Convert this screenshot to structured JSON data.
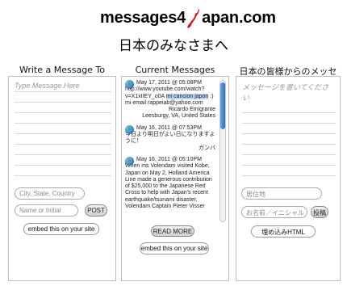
{
  "header": {
    "logo_left": "messages4",
    "logo_right": "apan.com",
    "subtitle": "日本のみなさまへ"
  },
  "left": {
    "title": "Write a Message To Japan",
    "message_placeholder": "Type Message Here",
    "location_placeholder": "City, State, Country",
    "name_placeholder": "Name or Initial",
    "post_label": "POST",
    "embed_label": "embed this on your site"
  },
  "middle": {
    "title": "Current Messages",
    "messages": [
      {
        "date": "May 17, 2011 @ 05:08PM",
        "body_a": "http://www.youtube.com/watch?v=X1xIIEY_o0A ",
        "body_hl": "mi cancion japon",
        "body_b": " :) mi email rappeiab@yahoo.com",
        "sig1": "Ricardo Emigrante",
        "sig2": "Leesburgy, VA, United States"
      },
      {
        "date": "May 16, 2011 @ 07:53PM",
        "body": "今日より明日がよい日になりますように！",
        "sig1": "ガンバ"
      },
      {
        "date": "May 16, 2011 @ 05:10PM",
        "body": "When ms Volendam visited Kobe, Japan on May 2, Holland America Line made a generous contribution of $25,000 to the Japanese Red Cross to help with Japan's recent earthquake/tsunami disaster. Volendam Captain Pieter Visser"
      }
    ],
    "read_more_label": "READ MORE",
    "embed_label": "embed this on your site"
  },
  "right": {
    "title": "日本の皆様からのメッセージ",
    "message_placeholder": "メッセージを書いてください",
    "location_placeholder": "居住地",
    "name_placeholder": "お名前／イニシャル",
    "post_label": "投稿",
    "embed_label": "埋め込みHTML"
  },
  "colors": {
    "logo_accent": "#d01818",
    "scroll_thumb": "#2c6fc2",
    "highlight": "#bcd6f5"
  }
}
